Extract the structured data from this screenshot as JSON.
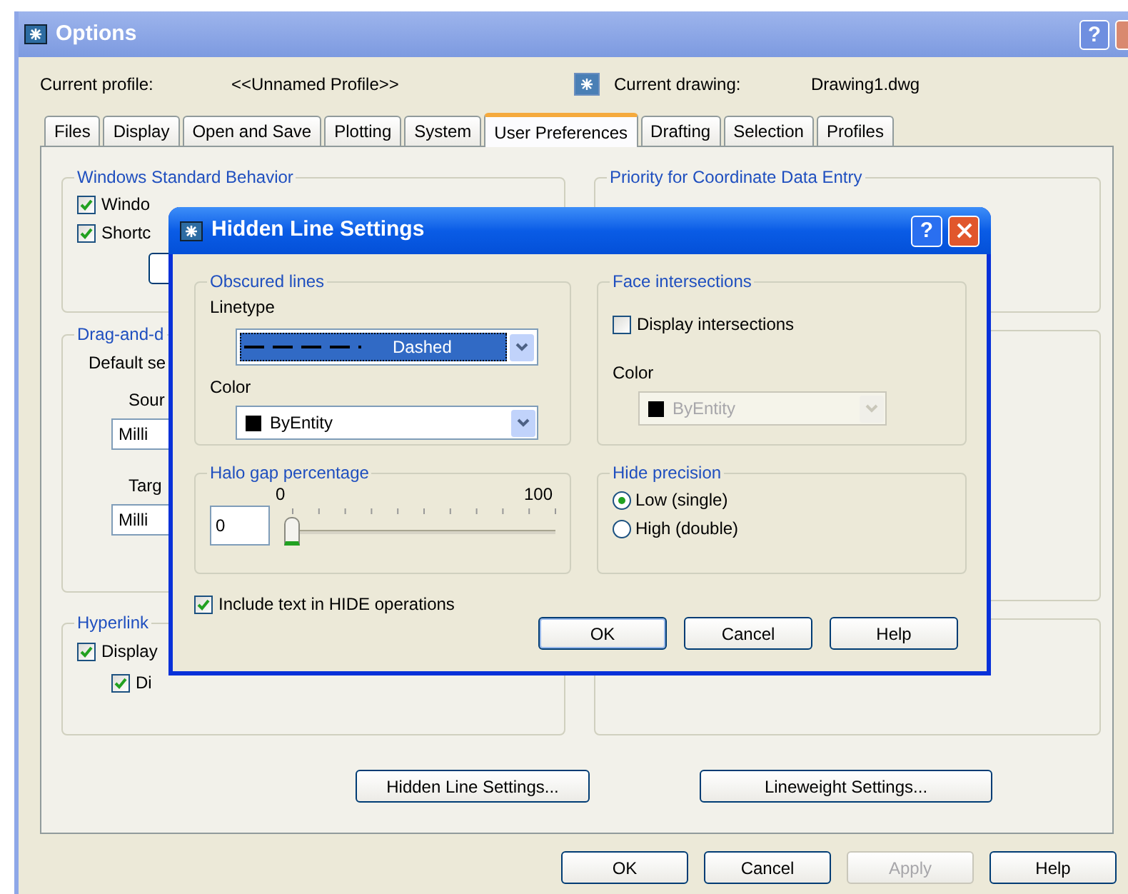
{
  "options_window": {
    "title": "Options",
    "help_button": "?",
    "current_profile_label": "Current profile:",
    "current_profile": "<<Unnamed Profile>>",
    "current_drawing_label": "Current drawing:",
    "current_drawing": "Drawing1.dwg",
    "tabs": [
      {
        "label": "Files",
        "selected": false
      },
      {
        "label": "Display",
        "selected": false
      },
      {
        "label": "Open and Save",
        "selected": false
      },
      {
        "label": "Plotting",
        "selected": false
      },
      {
        "label": "System",
        "selected": false
      },
      {
        "label": "User Preferences",
        "selected": true
      },
      {
        "label": "Drafting",
        "selected": false
      },
      {
        "label": "Selection",
        "selected": false
      },
      {
        "label": "Profiles",
        "selected": false
      }
    ],
    "windows_behavior": {
      "title": "Windows Standard Behavior",
      "checkboxes": [
        {
          "label": "Windo",
          "checked": true
        },
        {
          "label": "Shortc",
          "checked": true
        }
      ]
    },
    "coordinate_priority": {
      "title": "Priority for Coordinate Data Entry"
    },
    "drag_and_drop": {
      "title": "Drag-and-d",
      "default_label": "Default se",
      "source_label": "Sour",
      "source_value": "Milli",
      "target_label": "Targ",
      "target_value": "Milli"
    },
    "hyperlink": {
      "title": "Hyperlink",
      "checkboxes": [
        {
          "label": "Display",
          "checked": true
        },
        {
          "label": "Di",
          "checked": true
        }
      ]
    },
    "settings_buttons": [
      "Hidden Line Settings...",
      "Lineweight Settings..."
    ],
    "footer_buttons": [
      {
        "label": "OK",
        "disabled": false
      },
      {
        "label": "Cancel",
        "disabled": false
      },
      {
        "label": "Apply",
        "disabled": true
      },
      {
        "label": "Help",
        "disabled": false
      }
    ]
  },
  "hidden_line_dialog": {
    "title": "Hidden Line Settings",
    "help_button": "?",
    "obscured_lines": {
      "title": "Obscured lines",
      "linetype_label": "Linetype",
      "linetype": "Dashed",
      "color_label": "Color",
      "color_name": "ByEntity"
    },
    "face_intersections": {
      "title": "Face intersections",
      "display_label": "Display intersections",
      "display_checked": false,
      "color_label": "Color",
      "color_name": "ByEntity",
      "color_disabled": true
    },
    "halo_gap": {
      "title": "Halo gap percentage",
      "min": "0",
      "max": "100",
      "value": "0",
      "level": 0
    },
    "hide_precision": {
      "title": "Hide precision",
      "options": [
        {
          "label": "Low (single)",
          "selected": true
        },
        {
          "label": "High (double)",
          "selected": false
        }
      ]
    },
    "include_text": {
      "label": "Include text in HIDE operations",
      "checked": true
    },
    "buttons": [
      "OK",
      "Cancel",
      "Help"
    ]
  }
}
